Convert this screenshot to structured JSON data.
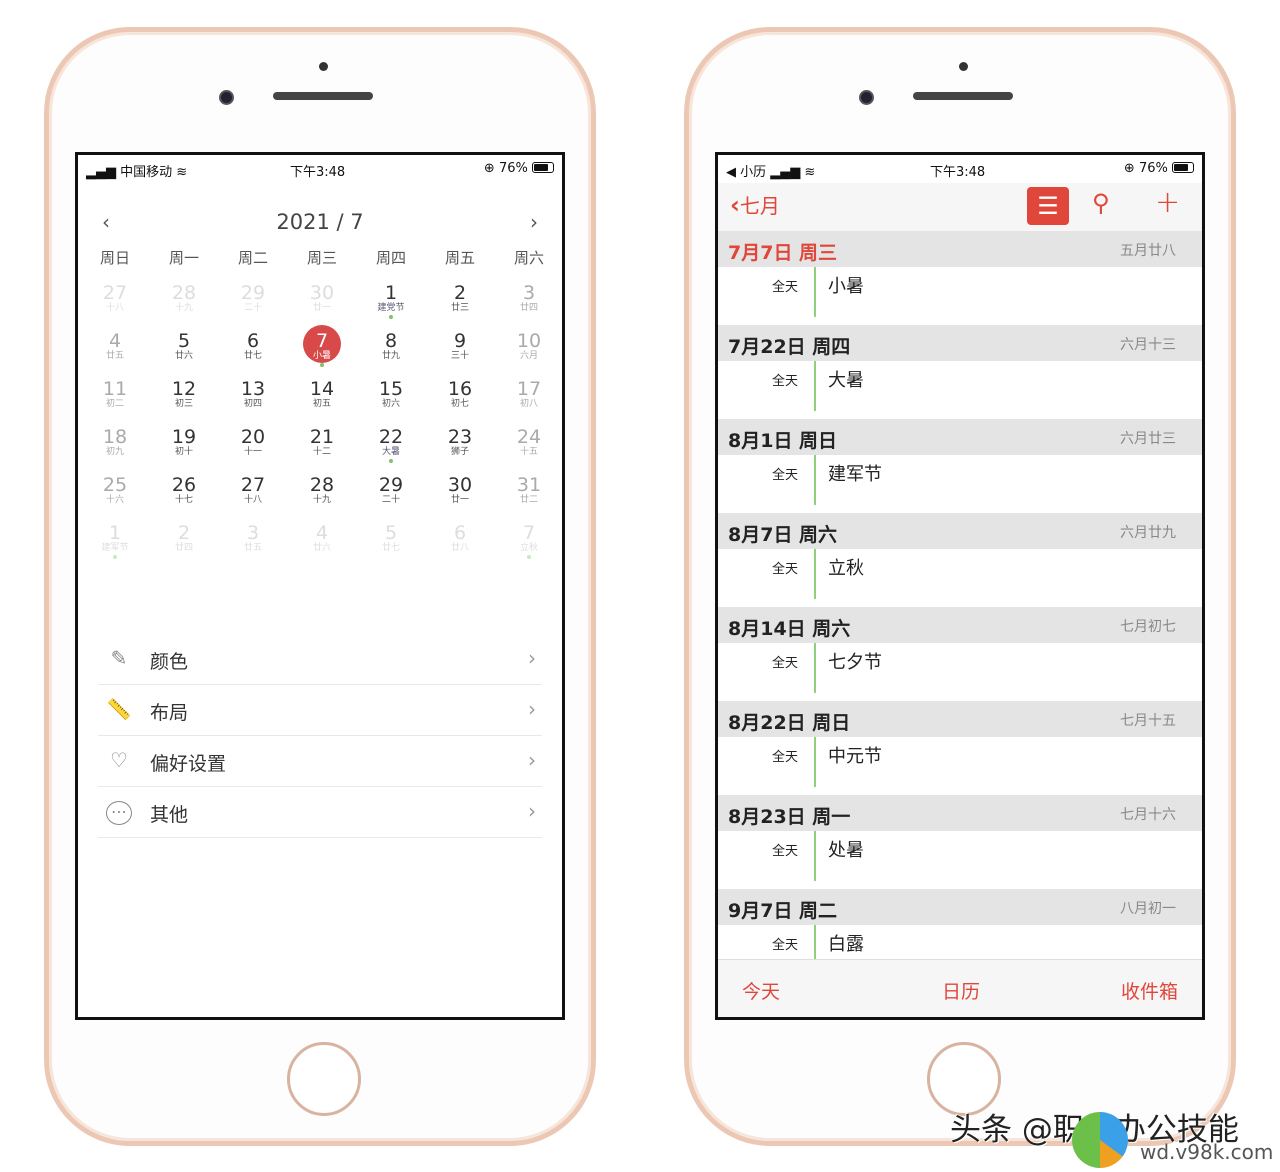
{
  "left": {
    "status": {
      "carrier": "中国移动",
      "time": "下午3:48",
      "battery": "76%"
    },
    "calendar": {
      "title": "2021 / 7",
      "prev": "‹",
      "next": "›",
      "weekdays": [
        "周日",
        "周一",
        "周二",
        "周三",
        "周四",
        "周五",
        "周六"
      ],
      "weeks": [
        [
          [
            "27",
            "十八",
            "om"
          ],
          [
            "28",
            "十九",
            "om"
          ],
          [
            "29",
            "二十",
            "om"
          ],
          [
            "30",
            "廿一",
            "om"
          ],
          [
            "1",
            "建党节",
            "hol"
          ],
          [
            "2",
            "廿三",
            ""
          ],
          [
            "3",
            "廿四",
            "we"
          ]
        ],
        [
          [
            "4",
            "廿五",
            "we"
          ],
          [
            "5",
            "廿六",
            ""
          ],
          [
            "6",
            "廿七",
            ""
          ],
          [
            "7",
            "小暑",
            "sel"
          ],
          [
            "8",
            "廿九",
            ""
          ],
          [
            "9",
            "三十",
            ""
          ],
          [
            "10",
            "六月",
            "we"
          ]
        ],
        [
          [
            "11",
            "初二",
            "we"
          ],
          [
            "12",
            "初三",
            ""
          ],
          [
            "13",
            "初四",
            ""
          ],
          [
            "14",
            "初五",
            ""
          ],
          [
            "15",
            "初六",
            ""
          ],
          [
            "16",
            "初七",
            ""
          ],
          [
            "17",
            "初八",
            "we"
          ]
        ],
        [
          [
            "18",
            "初九",
            "we"
          ],
          [
            "19",
            "初十",
            ""
          ],
          [
            "20",
            "十一",
            ""
          ],
          [
            "21",
            "十二",
            ""
          ],
          [
            "22",
            "大暑",
            "hol"
          ],
          [
            "23",
            "狮子",
            ""
          ],
          [
            "24",
            "十五",
            "we"
          ]
        ],
        [
          [
            "25",
            "十六",
            "we"
          ],
          [
            "26",
            "十七",
            ""
          ],
          [
            "27",
            "十八",
            ""
          ],
          [
            "28",
            "十九",
            ""
          ],
          [
            "29",
            "二十",
            ""
          ],
          [
            "30",
            "廿一",
            ""
          ],
          [
            "31",
            "廿二",
            "we"
          ]
        ],
        [
          [
            "1",
            "建军节",
            "omdot"
          ],
          [
            "2",
            "廿四",
            "om"
          ],
          [
            "3",
            "廿五",
            "om"
          ],
          [
            "4",
            "廿六",
            "om"
          ],
          [
            "5",
            "廿七",
            "om"
          ],
          [
            "6",
            "廿八",
            "om"
          ],
          [
            "7",
            "立秋",
            "omdot"
          ]
        ]
      ]
    },
    "menu": [
      {
        "label": "颜色",
        "icon": "brush-icon"
      },
      {
        "label": "布局",
        "icon": "ruler-icon"
      },
      {
        "label": "偏好设置",
        "icon": "heart-icon"
      },
      {
        "label": "其他",
        "icon": "more-icon"
      }
    ]
  },
  "right": {
    "status": {
      "back_app": "◀ 小历",
      "time": "下午3:48",
      "battery": "76%"
    },
    "nav": {
      "back": "七月"
    },
    "events": [
      {
        "date": "7月7日 周三",
        "lunar": "五月廿八",
        "allday": "全天",
        "name": "小暑",
        "today": true
      },
      {
        "date": "7月22日 周四",
        "lunar": "六月十三",
        "allday": "全天",
        "name": "大暑"
      },
      {
        "date": "8月1日 周日",
        "lunar": "六月廿三",
        "allday": "全天",
        "name": "建军节"
      },
      {
        "date": "8月7日 周六",
        "lunar": "六月廿九",
        "allday": "全天",
        "name": "立秋"
      },
      {
        "date": "8月14日 周六",
        "lunar": "七月初七",
        "allday": "全天",
        "name": "七夕节"
      },
      {
        "date": "8月22日 周日",
        "lunar": "七月十五",
        "allday": "全天",
        "name": "中元节"
      },
      {
        "date": "8月23日 周一",
        "lunar": "七月十六",
        "allday": "全天",
        "name": "处暑"
      },
      {
        "date": "9月7日 周二",
        "lunar": "八月初一",
        "allday": "全天",
        "name": "白露"
      }
    ],
    "tabs": [
      "今天",
      "日历",
      "收件箱"
    ]
  },
  "watermark": {
    "text": "头条 @职场办公技能",
    "site": "wd.v98k.com"
  },
  "colors": {
    "accent": "#e0473a",
    "today": "#d84a4a",
    "event_bar": "#8fd07c"
  }
}
